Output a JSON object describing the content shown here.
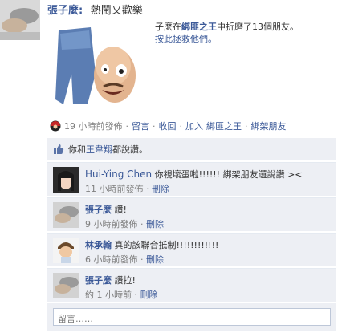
{
  "header": {
    "name": "張子麼:",
    "status": "熱鬧又歡樂"
  },
  "story": {
    "line1_prefix": "子麼在",
    "app_name": "綁匪之王",
    "line1_suffix": "中折磨了13個朋友。",
    "line2": "按此拯救他們。"
  },
  "meta": {
    "time": "19 小時前發佈",
    "sep": "·",
    "comment": "留言",
    "unlike": "收回",
    "join": "加入",
    "app": "綁匪之王",
    "kidnap": "綁架朋友"
  },
  "likes": {
    "prefix": "你和",
    "name": "王韋翔",
    "suffix": "都說讚。"
  },
  "comments": [
    {
      "name": "Hui-Ying Chen",
      "text": "你視壞蛋啦!!!!!! 綁架朋友還說讚 ><",
      "time": "11 小時前發佈",
      "delete": "刪除"
    },
    {
      "name": "張子麼",
      "text": "讚!",
      "time": "9 小時前發佈",
      "delete": "刪除"
    },
    {
      "name": "林承翰",
      "text": "真的該聯合抵制!!!!!!!!!!!!",
      "time": "6 小時前發佈",
      "delete": "刪除"
    },
    {
      "name": "張子麼",
      "text": "讚拉!",
      "time": "約 1 小時前",
      "delete": "刪除"
    }
  ],
  "input": {
    "placeholder": "留言……"
  },
  "colors": {
    "link": "#3b5998",
    "ufi_bg": "#edeff4",
    "meta": "#808080"
  }
}
